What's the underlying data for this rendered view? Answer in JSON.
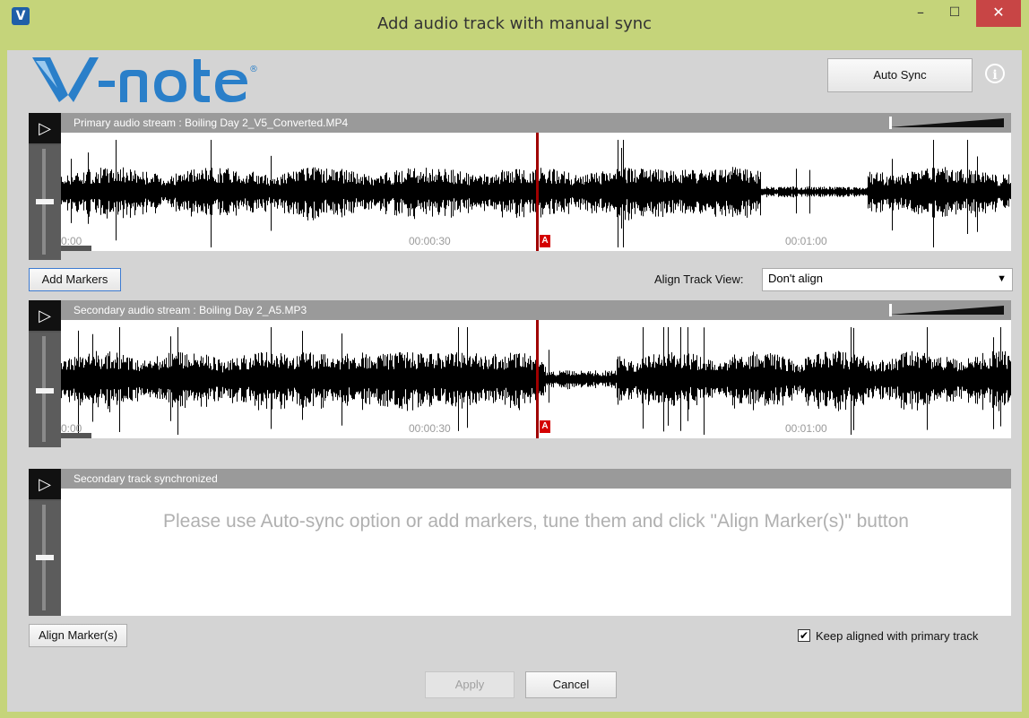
{
  "window": {
    "title": "Add audio track with manual sync",
    "app_icon": "V",
    "minimize_glyph": "–",
    "maximize_glyph": "☐",
    "close_glyph": "✕"
  },
  "toolbar": {
    "auto_sync_label": "Auto Sync",
    "info_glyph": "i"
  },
  "primary": {
    "title": "Primary audio stream : Boiling Day 2_V5_Converted.MP4",
    "play_glyph": "▷",
    "timecodes": [
      "0:00",
      "00:00:30",
      "00:01:00"
    ],
    "marker_label": "A"
  },
  "controls": {
    "add_markers_label": "Add Markers",
    "align_track_view_label": "Align Track View:",
    "align_option": "Don't align"
  },
  "secondary": {
    "title": "Secondary audio stream : Boiling Day 2_A5.MP3",
    "play_glyph": "▷",
    "timecodes": [
      "0:00",
      "00:00:30",
      "00:01:00"
    ],
    "marker_label": "A"
  },
  "synced": {
    "title": "Secondary track synchronized",
    "play_glyph": "▷",
    "message": "Please use Auto-sync option or add markers, tune them and click \"Align Marker(s)\" button"
  },
  "bottom": {
    "align_markers_label": "Align Marker(s)",
    "keep_aligned_label": "Keep aligned with primary track",
    "keep_aligned_checked": true,
    "check_glyph": "✔"
  },
  "footer": {
    "apply_label": "Apply",
    "apply_enabled": false,
    "cancel_label": "Cancel"
  },
  "logo": {
    "text": "V-note",
    "color": "#2a7fc9"
  }
}
